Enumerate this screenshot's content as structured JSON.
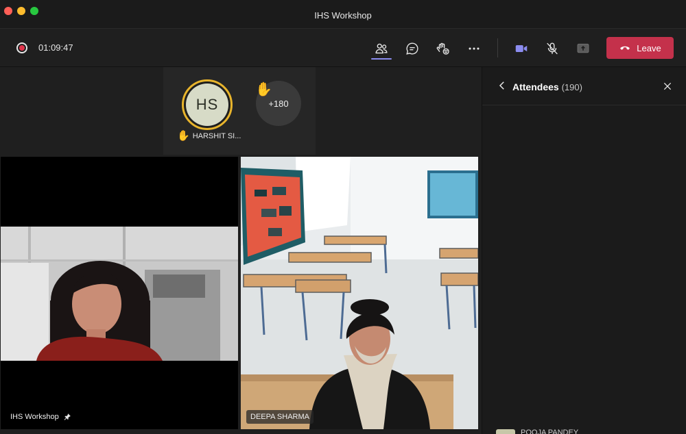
{
  "window": {
    "title": "IHS Workshop"
  },
  "toolbar": {
    "timer": "01:09:47",
    "leave_label": "Leave"
  },
  "strip": {
    "featured": {
      "initials": "HS",
      "name": "HARSHIT SI...",
      "hand_raised": true
    },
    "more_count": "+180"
  },
  "tiles": [
    {
      "name": "IHS Workshop",
      "pinned": true
    },
    {
      "name": "DEEPA SHARMA"
    }
  ],
  "sidebar": {
    "title": "Attendees",
    "count": "(190)",
    "partial_row": {
      "name": "POOJA PANDEY"
    }
  },
  "colors": {
    "leave": "#c4314b",
    "accent": "#8b8cf0",
    "video_icon": "#8b8cf0",
    "hand": "#e8b42c"
  }
}
